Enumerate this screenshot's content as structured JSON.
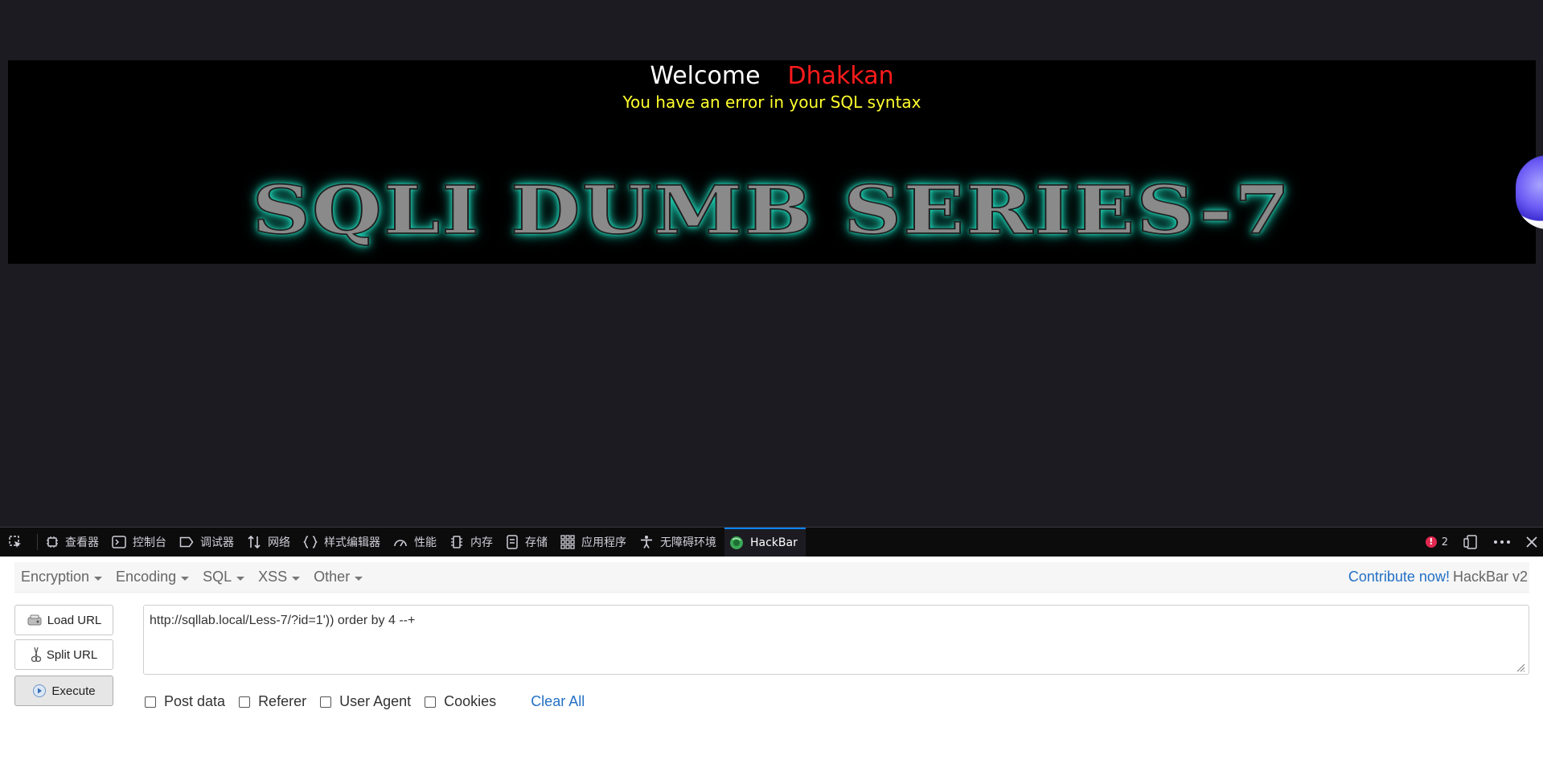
{
  "banner": {
    "welcome_word": "Welcome",
    "welcome_name": "Dhakkan",
    "error_message": "You have an error in your SQL syntax",
    "series_title": "SQLI DUMB SERIES-7"
  },
  "devtools": {
    "tabs": [
      {
        "label": "查看器",
        "icon": "inspector-icon"
      },
      {
        "label": "控制台",
        "icon": "console-icon"
      },
      {
        "label": "调试器",
        "icon": "debugger-icon"
      },
      {
        "label": "网络",
        "icon": "network-icon"
      },
      {
        "label": "样式编辑器",
        "icon": "style-editor-icon"
      },
      {
        "label": "性能",
        "icon": "performance-icon"
      },
      {
        "label": "内存",
        "icon": "memory-icon"
      },
      {
        "label": "存储",
        "icon": "storage-icon"
      },
      {
        "label": "应用程序",
        "icon": "application-icon"
      },
      {
        "label": "无障碍环境",
        "icon": "accessibility-icon"
      },
      {
        "label": "HackBar",
        "icon": "hackbar-icon"
      }
    ],
    "active_tab": "HackBar",
    "error_count": "2"
  },
  "hackbar": {
    "menu": {
      "encryption": "Encryption",
      "encoding": "Encoding",
      "sql": "SQL",
      "xss": "XSS",
      "other": "Other"
    },
    "contribute": "Contribute now!",
    "version": "HackBar v2",
    "buttons": {
      "load_url": "Load URL",
      "split_url": "Split URL",
      "execute": "Execute"
    },
    "url_value": "http://sqllab.local/Less-7/?id=1')) order by 4 --+",
    "options": {
      "post_data": "Post data",
      "referer": "Referer",
      "user_agent": "User Agent",
      "cookies": "Cookies"
    },
    "clear_all": "Clear All"
  },
  "colors": {
    "page_bg": "#1c1b22",
    "welcome_name": "#ff1b1b",
    "error_text": "#ffff2e",
    "title_glow": "#27e3c4",
    "link": "#2370c6",
    "active_tab_indicator": "#0a84ff"
  }
}
